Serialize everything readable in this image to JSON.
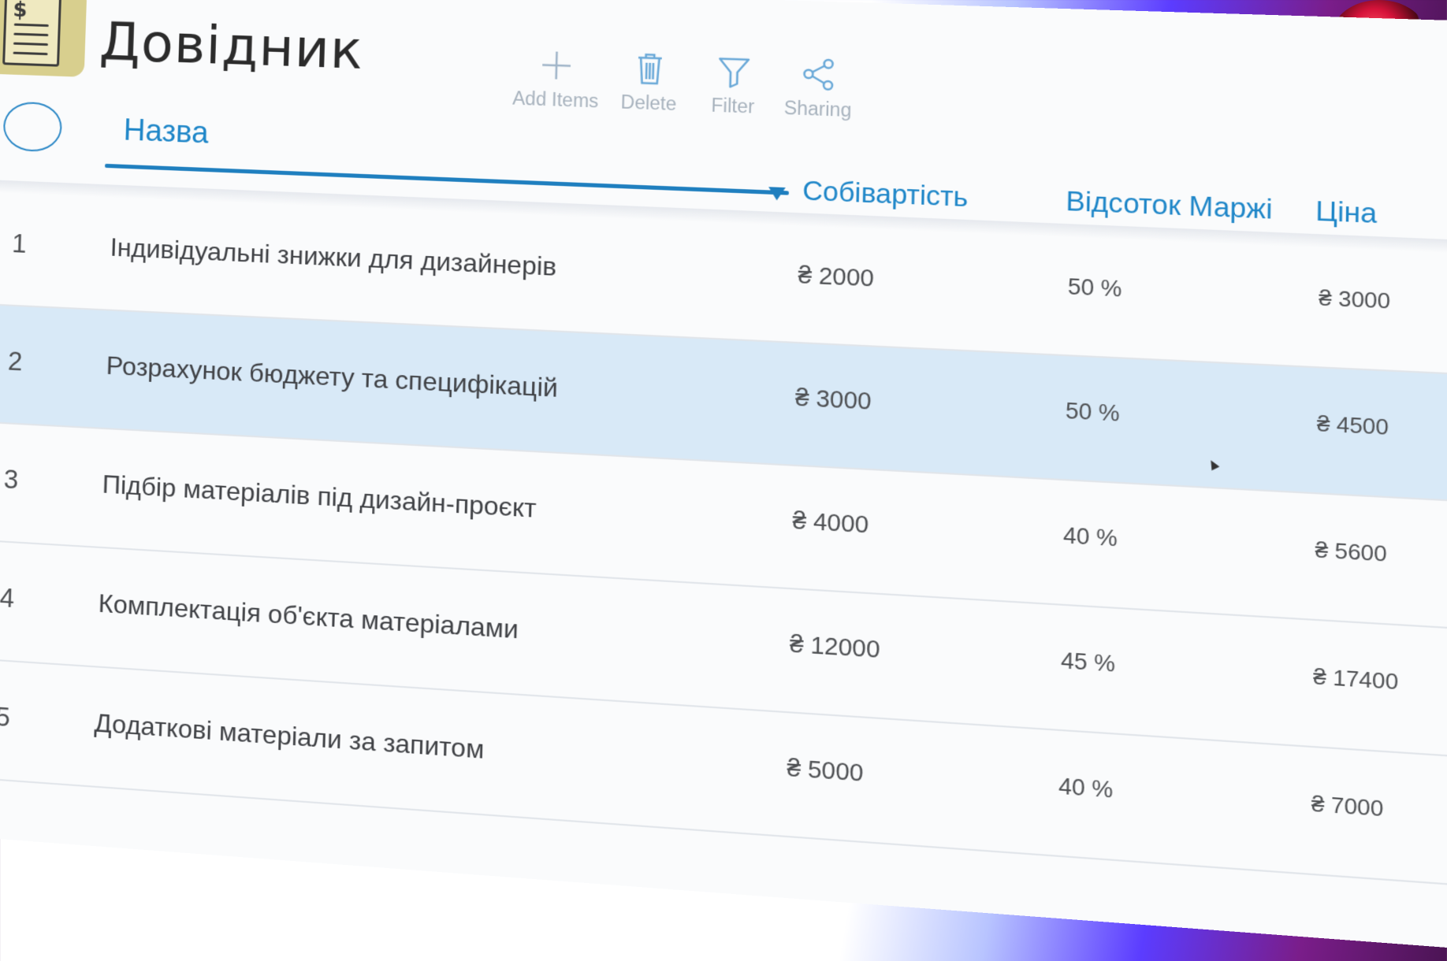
{
  "app": {
    "title": "Довідник",
    "accent_color": "#1e86c8",
    "selected_row_color": "#d8e9f7"
  },
  "toolbar": {
    "items": [
      {
        "label": "Add Items",
        "icon": "plus-icon"
      },
      {
        "label": "Delete",
        "icon": "trash-icon"
      },
      {
        "label": "Filter",
        "icon": "filter-icon"
      },
      {
        "label": "Sharing",
        "icon": "share-icon"
      }
    ]
  },
  "table": {
    "headers": {
      "name": "Назва",
      "cost": "Собівартість",
      "margin": "Відсоток Маржі",
      "price": "Ціна"
    },
    "sort_column": "cost",
    "rows": [
      {
        "num": "1",
        "name": "Індивідуальні знижки для дизайнерів",
        "cost": "₴ 2000",
        "margin": "50 %",
        "price": "₴ 3000",
        "selected": false
      },
      {
        "num": "2",
        "name": "Розрахунок бюджету та специфікацій",
        "cost": "₴ 3000",
        "margin": "50 %",
        "price": "₴ 4500",
        "selected": true
      },
      {
        "num": "3",
        "name": "Підбір матеріалів під дизайн-проєкт",
        "cost": "₴ 4000",
        "margin": "40 %",
        "price": "₴ 5600",
        "selected": false
      },
      {
        "num": "4",
        "name": "Комплектація об'єкта матеріалами",
        "cost": "₴ 12000",
        "margin": "45 %",
        "price": "₴ 17400",
        "selected": false
      },
      {
        "num": "5",
        "name": "Додаткові матеріали за запитом",
        "cost": "₴ 5000",
        "margin": "40 %",
        "price": "₴ 7000",
        "selected": false
      }
    ]
  }
}
